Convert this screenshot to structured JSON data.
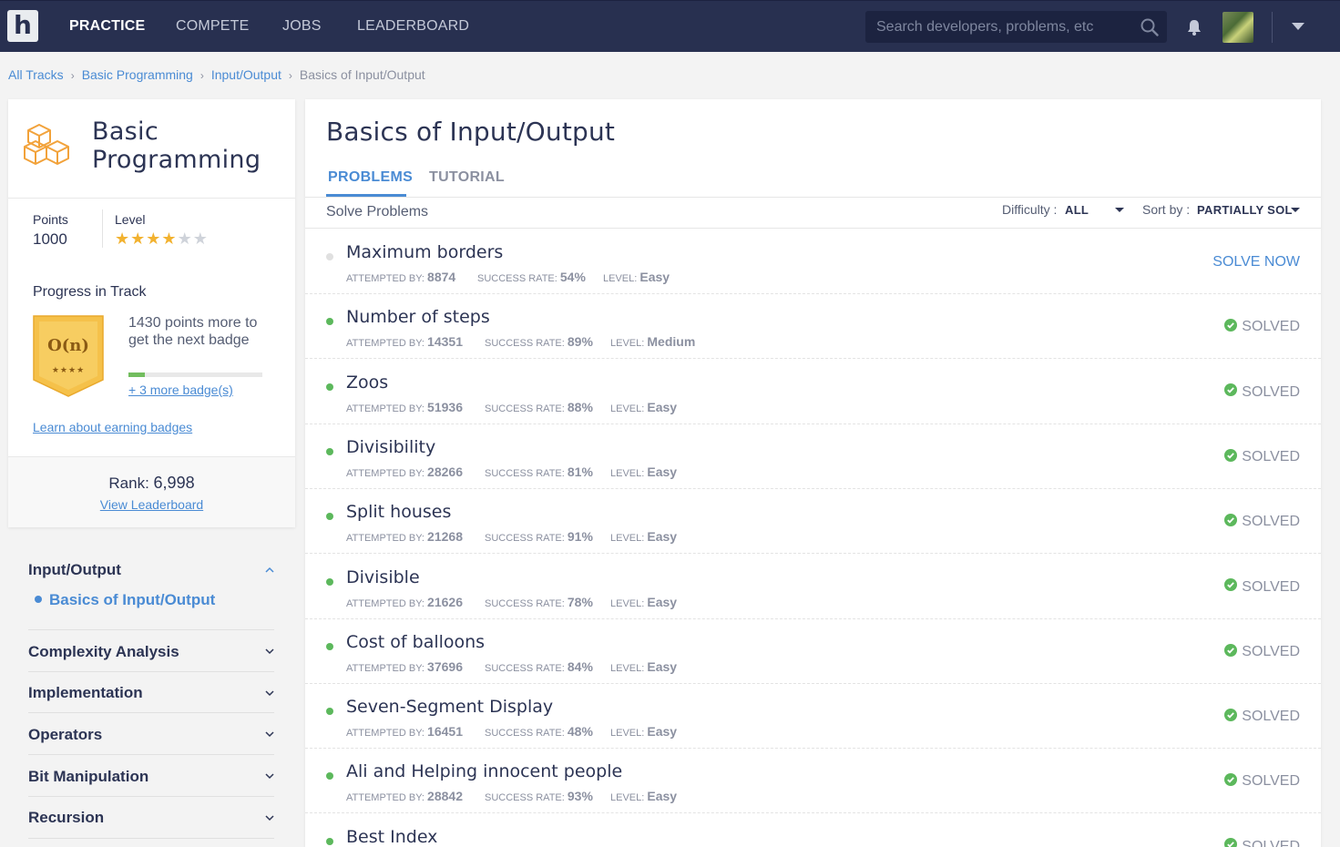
{
  "nav": {
    "logo": "h",
    "links": [
      "PRACTICE",
      "COMPETE",
      "JOBS",
      "LEADERBOARD"
    ],
    "search_placeholder": "Search developers, problems, etc"
  },
  "breadcrumb": [
    "All Tracks",
    "Basic Programming",
    "Input/Output",
    "Basics of Input/Output"
  ],
  "track": {
    "title": "Basic Programming",
    "points_label": "Points",
    "points_value": "1000",
    "level_label": "Level",
    "stars_filled": 4,
    "stars_total": 6,
    "progress_title": "Progress in Track",
    "badge_label": "O(n)",
    "badge_stars": "★★★★",
    "badge_text": "1430 points more to get the next badge",
    "badge_progress": 0.12,
    "more_badges": "+ 3 more badge(s)",
    "learn_link": "Learn about earning badges",
    "rank_label": "Rank:",
    "rank_value": "6,998",
    "leaderboard_link": "View Leaderboard"
  },
  "accordion": {
    "open_section": "Input/Output",
    "open_item": "Basics of Input/Output",
    "sections": [
      "Complexity Analysis",
      "Implementation",
      "Operators",
      "Bit Manipulation",
      "Recursion"
    ]
  },
  "main": {
    "title": "Basics of Input/Output",
    "tabs": [
      "PROBLEMS",
      "TUTORIAL"
    ],
    "solve_problems": "Solve Problems",
    "difficulty_label": "Difficulty :",
    "difficulty_value": "ALL",
    "sort_label": "Sort by :",
    "sort_value": "PARTIALLY SOL",
    "meta_labels": {
      "attempted": "ATTEMPTED BY:",
      "success": "SUCCESS RATE:",
      "level": "LEVEL:"
    },
    "problems": [
      {
        "name": "Maximum borders",
        "attempted": "8874",
        "success": "54%",
        "level": "Easy",
        "status": "SOLVE NOW",
        "solved": false
      },
      {
        "name": "Number of steps",
        "attempted": "14351",
        "success": "89%",
        "level": "Medium",
        "status": "SOLVED",
        "solved": true
      },
      {
        "name": "Zoos",
        "attempted": "51936",
        "success": "88%",
        "level": "Easy",
        "status": "SOLVED",
        "solved": true
      },
      {
        "name": "Divisibility",
        "attempted": "28266",
        "success": "81%",
        "level": "Easy",
        "status": "SOLVED",
        "solved": true
      },
      {
        "name": "Split houses",
        "attempted": "21268",
        "success": "91%",
        "level": "Easy",
        "status": "SOLVED",
        "solved": true
      },
      {
        "name": "Divisible",
        "attempted": "21626",
        "success": "78%",
        "level": "Easy",
        "status": "SOLVED",
        "solved": true
      },
      {
        "name": "Cost of balloons",
        "attempted": "37696",
        "success": "84%",
        "level": "Easy",
        "status": "SOLVED",
        "solved": true
      },
      {
        "name": "Seven-Segment Display",
        "attempted": "16451",
        "success": "48%",
        "level": "Easy",
        "status": "SOLVED",
        "solved": true
      },
      {
        "name": "Ali and Helping innocent people",
        "attempted": "28842",
        "success": "93%",
        "level": "Easy",
        "status": "SOLVED",
        "solved": true
      },
      {
        "name": "Best Index",
        "attempted": "",
        "success": "",
        "level": "",
        "status": "SOLVED",
        "solved": true
      }
    ]
  },
  "colors": {
    "nav_bg": "#283050",
    "accent": "#4a8bd4",
    "solved_green": "#5cb85c",
    "unsolved_dot": "#e0e0e0",
    "star": "#f2b230",
    "badge": "#f5c14a"
  },
  "icons": [
    "search-icon",
    "bell-icon",
    "chevron-down-icon",
    "chevron-up-icon",
    "check-circle-icon",
    "cubes-icon"
  ]
}
